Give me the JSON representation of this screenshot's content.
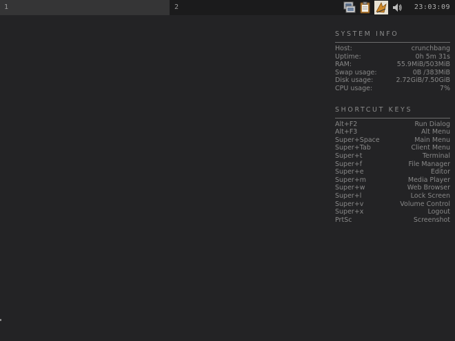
{
  "panel": {
    "workspaces": [
      {
        "label": "1"
      },
      {
        "label": "2"
      }
    ],
    "tray_icons": [
      "network-icon",
      "clipboard-icon",
      "update-icon",
      "volume-icon"
    ],
    "clock": "23:03:09"
  },
  "conky": {
    "system_info": {
      "title": "SYSTEM INFO",
      "rows": [
        {
          "label": "Host:",
          "value": "crunchbang"
        },
        {
          "label": "Uptime:",
          "value": "0h 5m 31s"
        },
        {
          "label": "RAM:",
          "value": "55.9MiB/503MiB"
        },
        {
          "label": "Swap usage:",
          "value": "0B /383MiB"
        },
        {
          "label": "Disk usage:",
          "value": "2.72GiB/7.50GiB"
        },
        {
          "label": "CPU usage:",
          "value": "7%"
        }
      ]
    },
    "shortcuts": {
      "title": "SHORTCUT KEYS",
      "rows": [
        {
          "label": "Alt+F2",
          "value": "Run Dialog"
        },
        {
          "label": "Alt+F3",
          "value": "Alt Menu"
        },
        {
          "label": "Super+Space",
          "value": "Main Menu"
        },
        {
          "label": "Super+Tab",
          "value": "Client Menu"
        },
        {
          "label": "Super+t",
          "value": "Terminal"
        },
        {
          "label": "Super+f",
          "value": "File Manager"
        },
        {
          "label": "Super+e",
          "value": "Editor"
        },
        {
          "label": "Super+m",
          "value": "Media Player"
        },
        {
          "label": "Super+w",
          "value": "Web Browser"
        },
        {
          "label": "Super+l",
          "value": "Lock Screen"
        },
        {
          "label": "Super+v",
          "value": "Volume Control"
        },
        {
          "label": "Super+x",
          "value": "Logout"
        },
        {
          "label": "PrtSc",
          "value": "Screenshot"
        }
      ]
    }
  }
}
